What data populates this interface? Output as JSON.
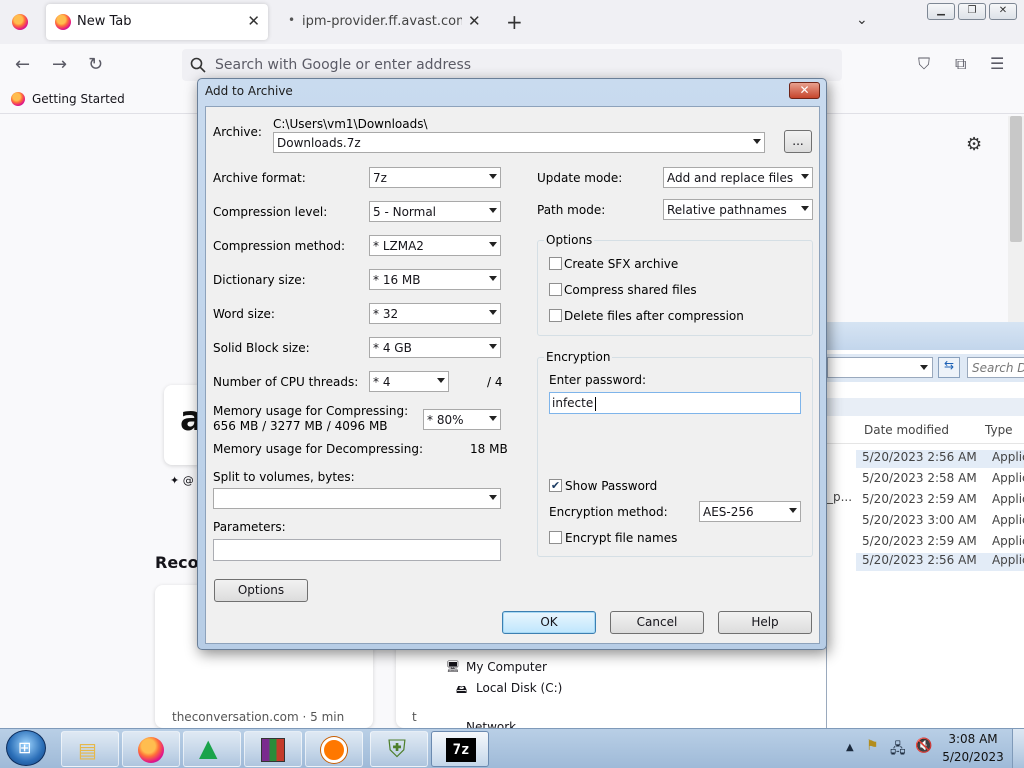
{
  "browser": {
    "tabs": [
      {
        "label": "New Tab",
        "active": true
      },
      {
        "label": "ipm-provider.ff.avast.com/?dat",
        "active": false
      }
    ],
    "new_tab_symbol": "+",
    "url_placeholder": "Search with Google or enter address",
    "bookmark": "Getting Started"
  },
  "newtab": {
    "section_heading": "Recor",
    "card_partial": "✦ @",
    "story_source": "theconversation.com · 5 min",
    "story_partial": "t"
  },
  "explorer": {
    "search_placeholder": "Search Do",
    "columns": [
      "Date modified",
      "Type"
    ],
    "rows": [
      {
        "date": "5/20/2023 2:56 AM",
        "type": "Applicat",
        "selected": true
      },
      {
        "date": "5/20/2023 2:58 AM",
        "type": "Applicat",
        "selected": false
      },
      {
        "date": "5/20/2023 2:59 AM",
        "type": "Applicat",
        "selected": false
      },
      {
        "date": "5/20/2023 3:00 AM",
        "type": "Applicat",
        "selected": false
      },
      {
        "date": "5/20/2023 2:59 AM",
        "type": "Applicat",
        "selected": false
      },
      {
        "date": "5/20/2023 2:56 AM",
        "type": "Applicat",
        "selected": true
      }
    ],
    "name_fragment": "_p...",
    "tree": [
      "My Computer",
      "Local Disk (C:)",
      "Network"
    ]
  },
  "dialog": {
    "title": "Add to Archive",
    "archive_label": "Archive:",
    "archive_path": "C:\\Users\\vm1\\Downloads\\",
    "archive_name": "Downloads.7z",
    "browse_label": "...",
    "left": {
      "archive_format": {
        "label": "Archive format:",
        "value": "7z"
      },
      "compression_level": {
        "label": "Compression level:",
        "value": "5 - Normal"
      },
      "compression_method": {
        "label": "Compression method:",
        "value": "* LZMA2"
      },
      "dictionary_size": {
        "label": "Dictionary size:",
        "value": "* 16 MB"
      },
      "word_size": {
        "label": "Word size:",
        "value": "* 32"
      },
      "solid_block_size": {
        "label": "Solid Block size:",
        "value": "* 4 GB"
      },
      "cpu_threads": {
        "label": "Number of CPU threads:",
        "value": "* 4",
        "max": "/ 4"
      },
      "mem_compress": {
        "label": "Memory usage for Compressing:",
        "detail": "656 MB / 3277 MB / 4096 MB",
        "value": "* 80%"
      },
      "mem_decompress": {
        "label": "Memory usage for Decompressing:",
        "value": "18 MB"
      },
      "split_label": "Split to volumes, bytes:",
      "split_value": "",
      "parameters_label": "Parameters:",
      "parameters_value": ""
    },
    "right": {
      "update_mode": {
        "label": "Update mode:",
        "value": "Add and replace files"
      },
      "path_mode": {
        "label": "Path mode:",
        "value": "Relative pathnames"
      },
      "options_title": "Options",
      "options": [
        {
          "label": "Create SFX archive",
          "checked": false
        },
        {
          "label": "Compress shared files",
          "checked": false
        },
        {
          "label": "Delete files after compression",
          "checked": false
        }
      ],
      "encryption_title": "Encryption",
      "enter_password_label": "Enter password:",
      "password_value": "infecte",
      "show_password": {
        "label": "Show Password",
        "checked": true
      },
      "encryption_method": {
        "label": "Encryption method:",
        "value": "AES-256"
      },
      "encrypt_names": {
        "label": "Encrypt file names",
        "checked": false
      }
    },
    "options_button": "Options",
    "ok_button": "OK",
    "cancel_button": "Cancel",
    "help_button": "Help"
  },
  "taskbar": {
    "time": "3:08 AM",
    "date": "5/20/2023",
    "apps": [
      "file-explorer-icon",
      "firefox-icon",
      "app-green-triangle-icon",
      "winrar-icon",
      "avast-icon",
      "antivirus-shield-icon",
      "7zip-icon"
    ]
  }
}
